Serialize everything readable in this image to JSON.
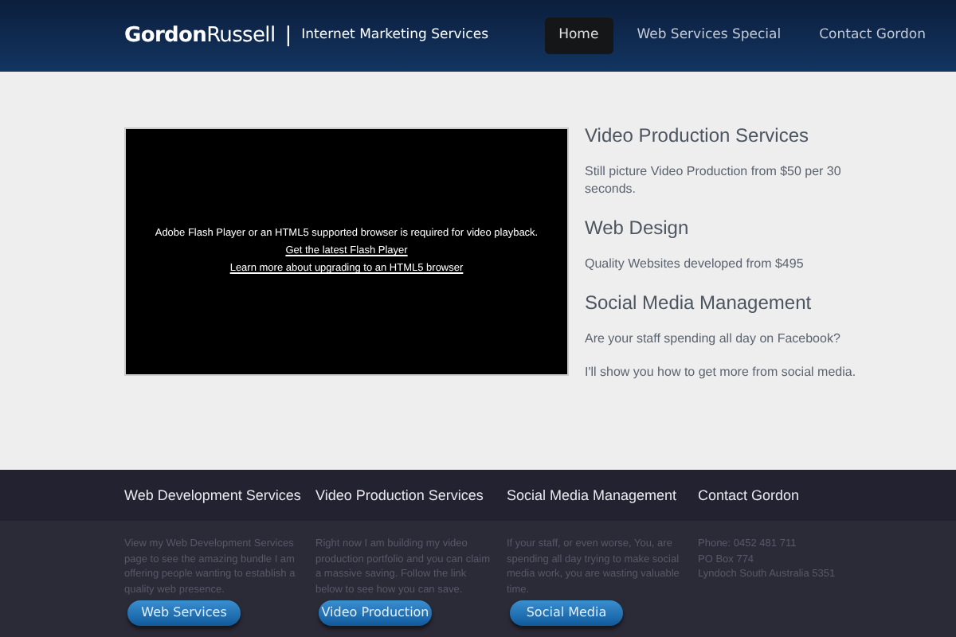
{
  "header": {
    "logo": "**Gordon**Russell",
    "separator": "|",
    "tagline": "Internet Marketing Services",
    "nav": [
      {
        "label": "Home",
        "selected": true
      },
      {
        "label": "Web Services Special",
        "selected": false
      },
      {
        "label": "Contact Gordon",
        "selected": false
      }
    ]
  },
  "video": {
    "message": "Adobe Flash Player or an HTML5 supported browser is required for video playback.",
    "links": [
      "Get the latest Flash Player",
      "Learn more about upgrading to an HTML5 browser"
    ]
  },
  "sections": [
    {
      "title": "Video Production Services",
      "paragraphs": [
        "Still picture Video Production from $50 per 30 seconds."
      ]
    },
    {
      "title": "Web Design",
      "paragraphs": [
        "Quality Websites developed from $495"
      ]
    },
    {
      "title": "Social Media Management",
      "paragraphs": [
        "Are your staff spending all day on Facebook?",
        "I'll show you how to get more from social media."
      ]
    }
  ],
  "footer": [
    {
      "title": "Web Development Services",
      "text": "View my Web Development Services page to see the amazing bundle I am offering people wanting to establish a quality web presence.",
      "button": "Web Services"
    },
    {
      "title": "Video Production Services",
      "text": "Right now I am building my video production portfolio and you can claim a massive saving. Follow the link below to see how you can save.",
      "button": "Video Production"
    },
    {
      "title": "Social Media Management",
      "text": "If your staff, or even worse, You, are spending all day trying to make social media work, you are wasting valuable time.",
      "button": "Social Media"
    },
    {
      "title": "Contact Gordon",
      "lines": [
        "Phone: 0452 481 711",
        "PO Box 774",
        "Lyndoch South Australia 5351"
      ]
    }
  ]
}
